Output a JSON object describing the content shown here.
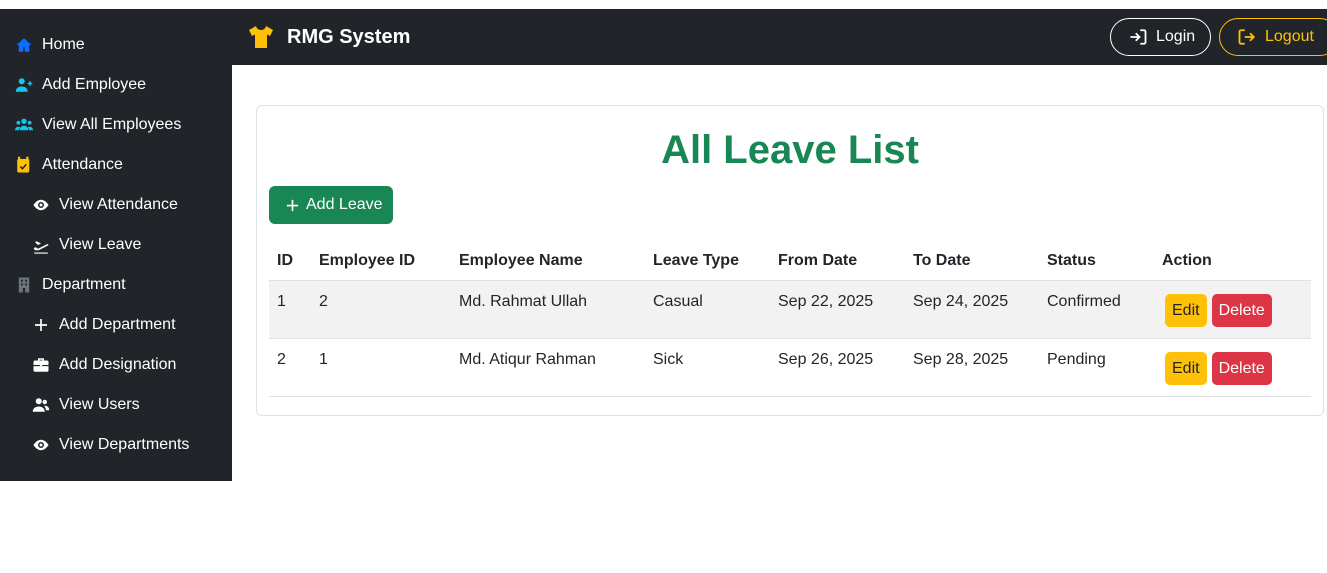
{
  "app": {
    "brand": "RMG System"
  },
  "topbar": {
    "login_label": "Login",
    "logout_label": "Logout"
  },
  "sidebar": {
    "items": [
      {
        "label": "Home",
        "icon": "home-icon",
        "level": 1,
        "color": "#0d6efd"
      },
      {
        "label": "Add Employee",
        "icon": "user-plus-icon",
        "level": 1,
        "color": "#0dcaf0"
      },
      {
        "label": "View All Employees",
        "icon": "users-icon",
        "level": 1,
        "color": "#0dcaf0"
      },
      {
        "label": "Attendance",
        "icon": "calendar-check-icon",
        "level": 1,
        "color": "#ffc107"
      },
      {
        "label": "View Attendance",
        "icon": "eye-icon",
        "level": 2,
        "color": "#ffffff"
      },
      {
        "label": "View Leave",
        "icon": "plane-departure-icon",
        "level": 2,
        "color": "#ffffff"
      },
      {
        "label": "Department",
        "icon": "building-icon",
        "level": 1,
        "color": "#6c757d"
      },
      {
        "label": "Add Department",
        "icon": "plus-icon",
        "level": 2,
        "color": "#ffffff"
      },
      {
        "label": "Add Designation",
        "icon": "briefcase-icon",
        "level": 2,
        "color": "#ffffff"
      },
      {
        "label": "View Users",
        "icon": "users-icon",
        "level": 2,
        "color": "#ffffff"
      },
      {
        "label": "View Departments",
        "icon": "eye-icon",
        "level": 2,
        "color": "#ffffff"
      }
    ]
  },
  "main": {
    "title": "All Leave List",
    "add_button_label": "Add Leave",
    "table": {
      "headers": [
        "ID",
        "Employee ID",
        "Employee Name",
        "Leave Type",
        "From Date",
        "To Date",
        "Status",
        "Action"
      ],
      "rows": [
        {
          "id": "1",
          "employee_id": "2",
          "employee_name": "Md. Rahmat Ullah",
          "leave_type": "Casual",
          "from_date": "Sep 22, 2025",
          "to_date": "Sep 24, 2025",
          "status": "Confirmed",
          "edit": "Edit",
          "delete": "Delete"
        },
        {
          "id": "2",
          "employee_id": "1",
          "employee_name": "Md. Atiqur Rahman",
          "leave_type": "Sick",
          "from_date": "Sep 26, 2025",
          "to_date": "Sep 28, 2025",
          "status": "Pending",
          "edit": "Edit",
          "delete": "Delete"
        }
      ]
    }
  },
  "colors": {
    "dark": "#212529",
    "success": "#198754",
    "warning": "#ffc107",
    "danger": "#dc3545",
    "primary": "#0d6efd",
    "info": "#0dcaf0"
  }
}
